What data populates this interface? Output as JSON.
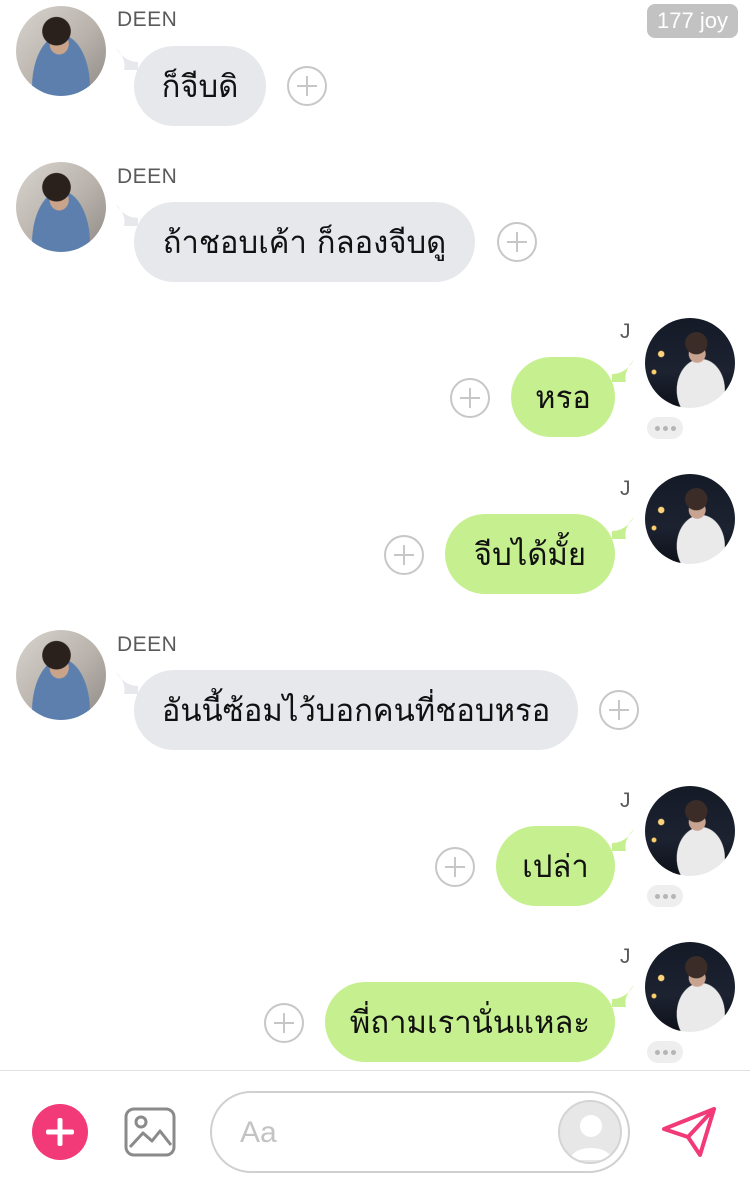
{
  "watermark": "177 joy",
  "messages": [
    {
      "sender": "DEEN",
      "side": "in",
      "text": "ก็จีบดิ"
    },
    {
      "sender": "DEEN",
      "side": "in",
      "text": "ถ้าชอบเค้า ก็ลองจีบดู"
    },
    {
      "sender": "J",
      "side": "out",
      "text": "หรอ"
    },
    {
      "sender": "J",
      "side": "out",
      "text": "จีบได้มั้ย"
    },
    {
      "sender": "DEEN",
      "side": "in",
      "text": "อันนี้ซ้อมไว้บอกคนที่ชอบหรอ"
    },
    {
      "sender": "J",
      "side": "out",
      "text": "เปล่า"
    },
    {
      "sender": "J",
      "side": "out",
      "text": "พี่ถามเรานั่นแหละ"
    }
  ],
  "composer": {
    "placeholder": "Aa",
    "icons": {
      "add": "plus-circle-icon",
      "image": "image-icon",
      "profile": "person-icon",
      "send": "send-icon"
    },
    "accent_color": "#f23a78"
  },
  "colors": {
    "incoming_bubble": "#e6e8ec",
    "outgoing_bubble": "#c6f08f"
  }
}
